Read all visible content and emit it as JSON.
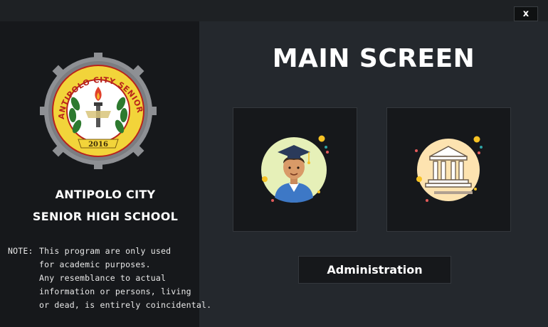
{
  "window": {
    "close_label": "x"
  },
  "sidebar": {
    "logo": {
      "ring_text": "ANTIPOLO CITY SENIOR HIGH SCHOOL",
      "year": "2016"
    },
    "school_name_line1": "ANTIPOLO CITY",
    "school_name_line2": "SENIOR HIGH SCHOOL",
    "note_label": "NOTE:",
    "note_lines": [
      "This program are only used",
      "for academic purposes.",
      "Any resemblance to actual",
      "information or persons, living",
      "or dead, is entirely coincidental."
    ]
  },
  "main": {
    "title": "MAIN SCREEN",
    "tiles": [
      {
        "icon": "student-icon"
      },
      {
        "icon": "school-building-icon"
      }
    ],
    "admin_button_label": "Administration"
  },
  "colors": {
    "sidebar_bg": "#16181b",
    "main_bg": "#24282d",
    "tile_bg": "#16181b",
    "student_circle": "#e6f0b8",
    "building_circle": "#fde3b0",
    "logo_gear": "#8e9094",
    "logo_ring": "#f2d43a"
  }
}
